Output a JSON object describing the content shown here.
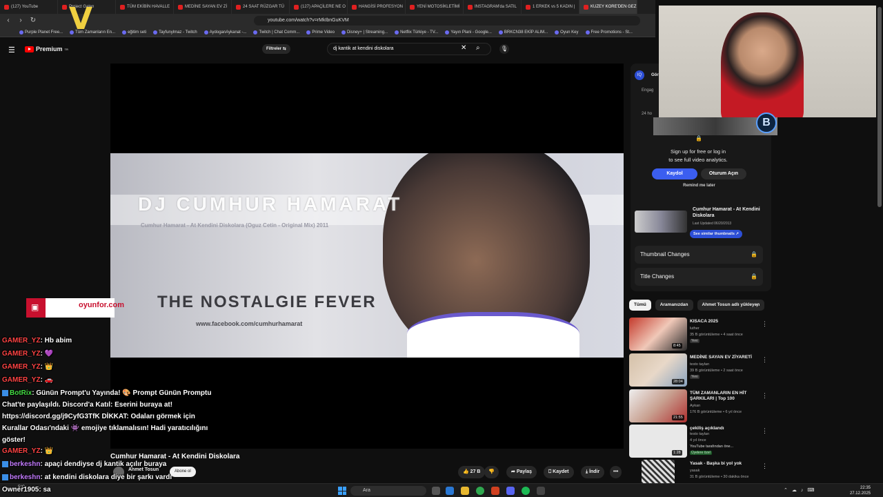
{
  "browser": {
    "tabs": [
      {
        "label": "(127) YouTube",
        "active": false
      },
      {
        "label": "Project Galen",
        "active": false
      },
      {
        "label": "TÜM EKİBİN HAVALLE",
        "active": false
      },
      {
        "label": "MEDİNE SAYAN EV Zİ",
        "active": false
      },
      {
        "label": "24 SAAT RÜZGAR TÜ",
        "active": false
      },
      {
        "label": "(127) APAÇİLERE NE O",
        "active": false
      },
      {
        "label": "HANGİSİ PROFESYON",
        "active": false
      },
      {
        "label": "YENİ MOTOSİKLETİMİ",
        "active": false
      },
      {
        "label": "INSTAGRAM'da SATIL",
        "active": false
      },
      {
        "label": "1 ERKEK vs 5 KADIN |",
        "active": false
      },
      {
        "label": "KUZEY KORE'DEN GEZ",
        "active": true
      }
    ],
    "url": "youtube.com/watch?v=rMkIbnGuKVM",
    "bookmarks": [
      "Purple Planet Free...",
      "Tüm Zamanların En...",
      "eğitim seti",
      "Tayfunylmaz - Twitch",
      "AydoganAykanat -...",
      "Twitch | Chat Comm...",
      "Prime Video",
      "Disney+ | Streaming...",
      "Netflix Türkiye - TV...",
      "Yayın Plani - Google...",
      "BRKCN38 EKİP ALIM...",
      "Oyun Key",
      "Free Promotions - St..."
    ]
  },
  "youtube": {
    "logo_label": "Premium",
    "logo_suffix": "TR",
    "filters_label": "Filtreler",
    "search_value": "dj kantik at kendini diskolara",
    "thumbnail": {
      "dj_name": "DJ CUMHUR HAMARAT",
      "subtitle": "Cumhur Hamarat - At Kendini Diskolara (Oguz Cetin - Original Mix) 2011",
      "headline": "THE NOSTALGIE FEVER",
      "url_text": "www.facebook.com/cumhurhamarat"
    },
    "video_title": "Cumhur Hamarat - At Kendini Diskolara",
    "channel_name": "Ahmet Tosun",
    "subscribe_label": "Abone ol",
    "actions": {
      "likes": "27 B",
      "share": "Paylaş",
      "save": "Kaydet",
      "download": "İndir",
      "more": "•••"
    }
  },
  "extension_panel": {
    "header_partial": "Gör",
    "engage_partial": "Engag",
    "hours_partial": "24 ho",
    "signup_text_line1": "Sign up for free or log in",
    "signup_text_line2": "to see full video analytics.",
    "register_label": "Kaydol",
    "login_label": "Oturum Açın",
    "remind_label": "Remind me later",
    "similar": {
      "title": "Cumhur Hamarat - At Kendini Diskolara",
      "date": "Last Updated 06/20/2013",
      "button": "See similar thumbnails ↗"
    },
    "thumbnail_changes": "Thumbnail Changes",
    "title_changes": "Title Changes",
    "lock_icon": "🔒"
  },
  "recommendations": {
    "chips": [
      {
        "label": "Tümü",
        "active": true
      },
      {
        "label": "Aramanızdan",
        "active": false
      },
      {
        "label": "Ahmet Tosun adlı yükleyen",
        "active": false
      }
    ],
    "items": [
      {
        "title": "KISACA 2025",
        "channel": "luther",
        "meta": "35 B görüntüleme • 4 saat önce",
        "badge": "Yeni",
        "duration": "8:45",
        "thumb_color": "#b83a30"
      },
      {
        "title": "MEDİNE SAYAN EV ZİYARETİ",
        "channel": "testo taylan",
        "meta": "39 B görüntüleme • 2 saat önce",
        "badge": "Yeni",
        "duration": "28:04",
        "thumb_color": "#c8b8a8"
      },
      {
        "title": "TÜM ZAMANLARIN EN HİT ŞARKILARI | Top 100",
        "channel": "Aykan",
        "meta": "176 B görüntüleme • 6 yıl önce",
        "badge": "",
        "duration": "21:55",
        "thumb_color": "#d0c8c4"
      },
      {
        "title": "çekiliş açıklandı",
        "channel": "testo taylan",
        "meta": "4 yıl önce",
        "extra": "YouTube tarafından öne...",
        "badge": "Üyelere özel",
        "duration": "1:28",
        "thumb_color": "#e8e8e8"
      },
      {
        "title": "Yasak - Başka bi yol yok",
        "channel": "yasak",
        "meta": "31 B görüntüleme • 30 dakika önce",
        "badge": "",
        "duration": "",
        "thumb_color": "#333333"
      }
    ]
  },
  "overlay": {
    "sponsor_label": "oyunfor.com",
    "chat": [
      {
        "user": "GAMER_YZ",
        "text": ": Hb abim",
        "color": "red"
      },
      {
        "user": "GAMER_YZ",
        "text": ": 💜",
        "color": "red"
      },
      {
        "user": "GAMER_YZ",
        "text": ": 👑",
        "color": "red"
      },
      {
        "user": "GAMER_YZ",
        "text": ": 🚗",
        "color": "red"
      },
      {
        "user": "BotRix",
        "text": ": Günün Prompt'u Yayında! 🎨 Prompt Günün Promptu Chat'te paylaşıldı. Discord'a Katıl: Eserini buraya at! https://discord.gg/j9CyfG3TfK DİKKAT: Odaları görmek için Kurallar Odası'ndaki 👾 emojiye tıklamalısın! Hadi yaratıcılığını göster!",
        "color": "green"
      },
      {
        "user": "GAMER_YZ",
        "text": ": 👑",
        "color": "red"
      },
      {
        "user": "berkeshn",
        "text": ": apaçi dendiyse dj kantik açılır buraya",
        "color": "purple"
      },
      {
        "user": "berkeshn",
        "text": ": at kendini diskolara diye bir şarkı vardı",
        "color": "purple"
      },
      {
        "user": "Owner1905",
        "text": ": sa",
        "color": "white"
      }
    ]
  },
  "taskbar": {
    "weather": "5°C",
    "search_placeholder": "Ara",
    "time": "22:35",
    "date": "27.12.2025"
  },
  "colors": {
    "background": "#0f0f0f",
    "accent_red": "#ff0000",
    "register_blue": "#3b5ef0",
    "sponsor_red": "#c8102e"
  }
}
